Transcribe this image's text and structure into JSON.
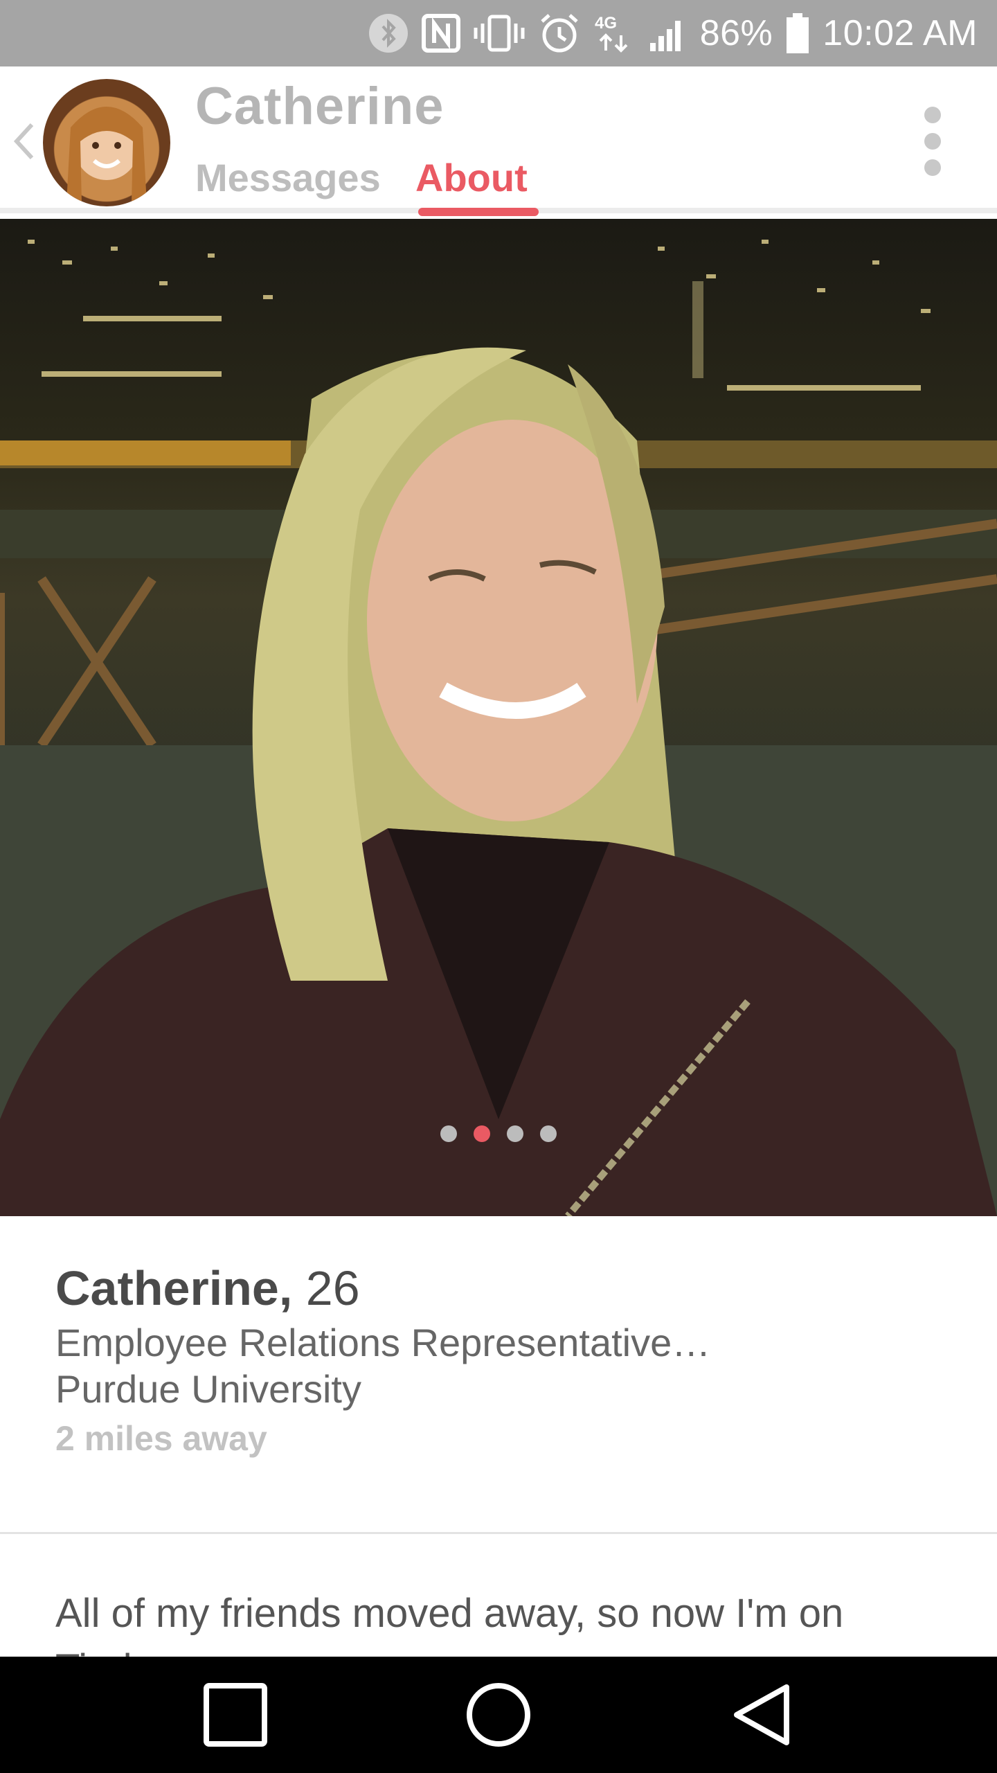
{
  "status_bar": {
    "battery_percent": "86%",
    "time": "10:02 AM",
    "network_label": "4G",
    "icons": [
      "bluetooth-icon",
      "nfc-icon",
      "vibrate-icon",
      "alarm-icon",
      "network-4g-icon",
      "signal-icon",
      "battery-icon"
    ]
  },
  "header": {
    "title": "Catherine",
    "tabs": [
      {
        "label": "Messages",
        "active": false
      },
      {
        "label": "About",
        "active": true
      }
    ],
    "accent_color": "#ea5a63"
  },
  "photo": {
    "total_photos": 4,
    "current_index": 2
  },
  "profile": {
    "name": "Catherine,",
    "age": "26",
    "job": " Employee Relations Representative…",
    "school": "Purdue University",
    "distance": "2 miles away",
    "bio": "All of my friends moved away, so now I'm on Tinder"
  },
  "nav_bar": {
    "buttons": [
      "recents-button",
      "home-button",
      "back-button"
    ]
  }
}
